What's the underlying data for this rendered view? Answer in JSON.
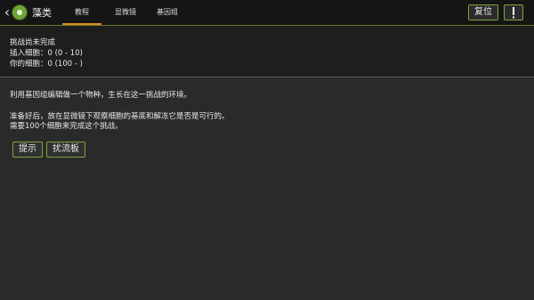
{
  "header": {
    "app_title": "藻类",
    "tabs": [
      {
        "label": "教程",
        "active": true
      },
      {
        "label": "显微镜",
        "active": false
      },
      {
        "label": "基因组",
        "active": false
      }
    ],
    "reset_label": "复位",
    "back_icon": "chevron-left-icon",
    "app_icon": "algae-icon",
    "info_icon": "exclamation-icon",
    "accent_color": "#e08a1e",
    "border_color": "#7ca53c"
  },
  "status": {
    "line1": "挑战尚未完成",
    "line2": "插入细胞：0 (0 - 10)",
    "line3": "你的细胞：0 (100 - )"
  },
  "description": {
    "line1": "利用基因组编辑做一个物种，生长在这一挑战的环境。",
    "line2": "准备好后，放在显微镜下观察细胞的基底和解冻它是否是可行的。",
    "line3": "需要100个细胞来完成这个挑战。"
  },
  "actions": {
    "hint_label": "提示",
    "board_label": "扰流板"
  }
}
